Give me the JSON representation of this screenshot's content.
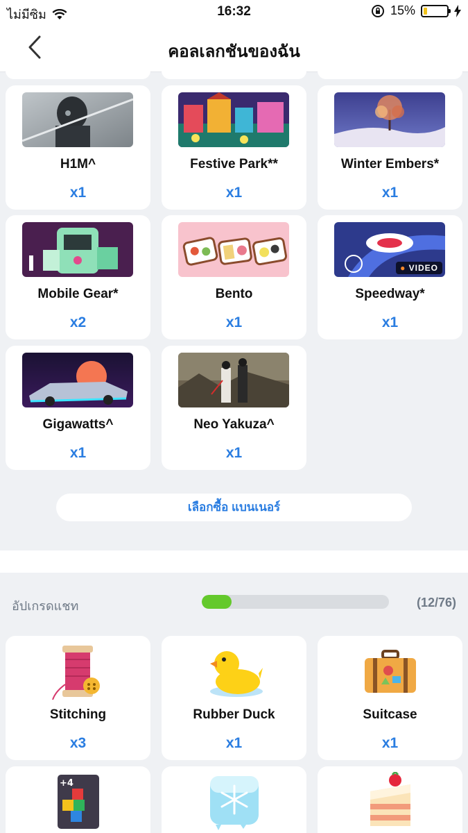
{
  "status_bar": {
    "carrier": "ไม่มีซิม",
    "time": "16:32",
    "battery": "15%",
    "battery_level": 0.15
  },
  "nav": {
    "title": "คอลเลกชันของฉัน"
  },
  "banners": [
    {
      "name": "H1M^",
      "count": "x1"
    },
    {
      "name": "Festive Park**",
      "count": "x1"
    },
    {
      "name": "Winter Embers*",
      "count": "x1"
    },
    {
      "name": "Mobile Gear*",
      "count": "x2"
    },
    {
      "name": "Bento",
      "count": "x1"
    },
    {
      "name": "Speedway*",
      "count": "x1",
      "tag": "VIDEO"
    },
    {
      "name": "Gigawatts^",
      "count": "x1"
    },
    {
      "name": "Neo Yakuza^",
      "count": "x1"
    }
  ],
  "buy_banner_label": "เลือกซื้อ แบนเนอร์",
  "upgrades": {
    "label": "อัปเกรดแชท",
    "progress_text": "(12/76)",
    "progress_fraction": 0.158,
    "items": [
      {
        "name": "Stitching",
        "count": "x3"
      },
      {
        "name": "Rubber Duck",
        "count": "x1"
      },
      {
        "name": "Suitcase",
        "count": "x1"
      }
    ]
  },
  "colors": {
    "accent": "#2a7de1",
    "progress": "#64c92c",
    "background": "#eff1f4"
  }
}
